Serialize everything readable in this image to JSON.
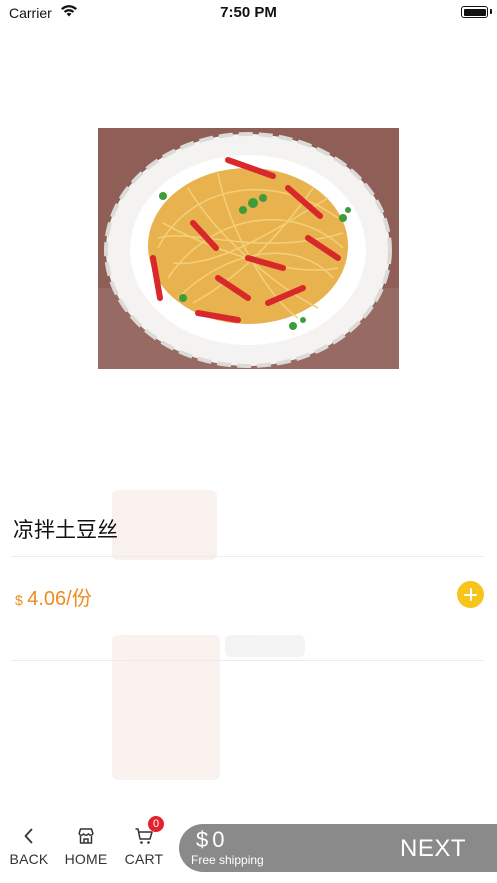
{
  "status_bar": {
    "carrier": "Carrier",
    "time": "7:50 PM"
  },
  "product": {
    "image_icon": "cold-potato-shreds-dish-photo",
    "name": "凉拌土豆丝",
    "price_currency": "$",
    "price_amount": "4.06/份"
  },
  "bottom_nav": {
    "back_label": "BACK",
    "home_label": "HOME",
    "cart_label": "CART",
    "cart_badge": "0",
    "total_symbol": "$",
    "total_value": "0",
    "shipping_text": "Free shipping",
    "next_label": "NEXT"
  },
  "colors": {
    "price": "#f08a1f",
    "add_button": "#f7c41c",
    "badge": "#e4212e",
    "checkout_bar": "#8a8a8a"
  }
}
